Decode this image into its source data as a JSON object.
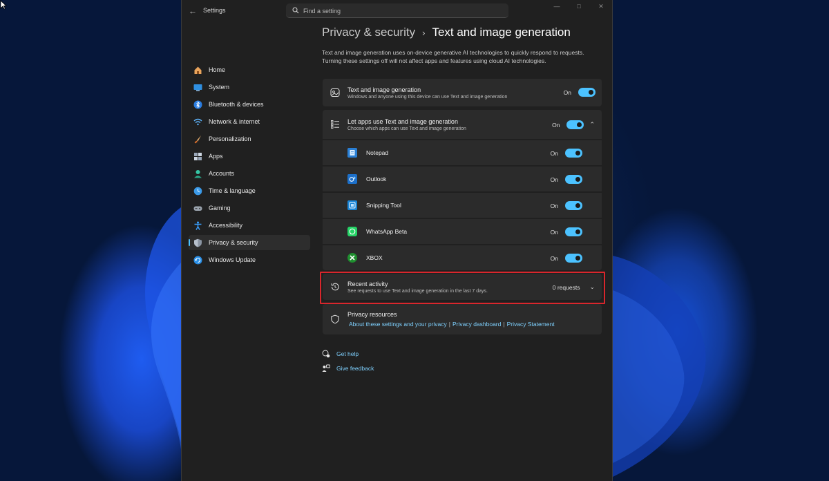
{
  "window": {
    "title": "Settings"
  },
  "search": {
    "placeholder": "Find a setting"
  },
  "nav": {
    "items": [
      {
        "label": "Home",
        "icon": "home-icon",
        "active": false
      },
      {
        "label": "System",
        "icon": "system-icon",
        "active": false
      },
      {
        "label": "Bluetooth & devices",
        "icon": "bluetooth-icon",
        "active": false
      },
      {
        "label": "Network & internet",
        "icon": "wifi-icon",
        "active": false
      },
      {
        "label": "Personalization",
        "icon": "brush-icon",
        "active": false
      },
      {
        "label": "Apps",
        "icon": "apps-icon",
        "active": false
      },
      {
        "label": "Accounts",
        "icon": "accounts-icon",
        "active": false
      },
      {
        "label": "Time & language",
        "icon": "globe-clock-icon",
        "active": false
      },
      {
        "label": "Gaming",
        "icon": "gamepad-icon",
        "active": false
      },
      {
        "label": "Accessibility",
        "icon": "accessibility-icon",
        "active": false
      },
      {
        "label": "Privacy & security",
        "icon": "shield-icon",
        "active": true
      },
      {
        "label": "Windows Update",
        "icon": "update-icon",
        "active": false
      }
    ]
  },
  "header": {
    "parent": "Privacy & security",
    "separator": "›",
    "current": "Text and image generation"
  },
  "description": "Text and image generation uses on-device generative AI technologies to quickly respond to requests. Turning these settings off will not affect apps and features using cloud AI technologies.",
  "main_setting": {
    "title": "Text and image generation",
    "subtitle": "Windows and anyone using this device can use Text and image generation",
    "state": "On"
  },
  "apps_setting": {
    "title": "Let apps use Text and image generation",
    "subtitle": "Choose which apps can use Text and image generation",
    "state": "On",
    "apps": [
      {
        "name": "Notepad",
        "state": "On",
        "color": "#2a7fd4"
      },
      {
        "name": "Outlook",
        "state": "On",
        "color": "#1c6fc9"
      },
      {
        "name": "Snipping Tool",
        "state": "On",
        "color": "#1a86d8"
      },
      {
        "name": "WhatsApp Beta",
        "state": "On",
        "color": "#25d366"
      },
      {
        "name": "XBOX",
        "state": "On",
        "color": "#1f8f2f"
      }
    ]
  },
  "recent_activity": {
    "title": "Recent activity",
    "subtitle": "See requests to use Text and image generation in the last 7 days.",
    "value": "0 requests"
  },
  "privacy_resources": {
    "title": "Privacy resources",
    "links": [
      "About these settings and your privacy",
      "Privacy dashboard",
      "Privacy Statement"
    ],
    "separator": "|"
  },
  "help": {
    "get_help": "Get help",
    "give_feedback": "Give feedback"
  },
  "colors": {
    "accent": "#4cc2ff",
    "highlight": "#d9262c",
    "window_bg": "#202020",
    "card_bg": "#2b2b2b"
  }
}
